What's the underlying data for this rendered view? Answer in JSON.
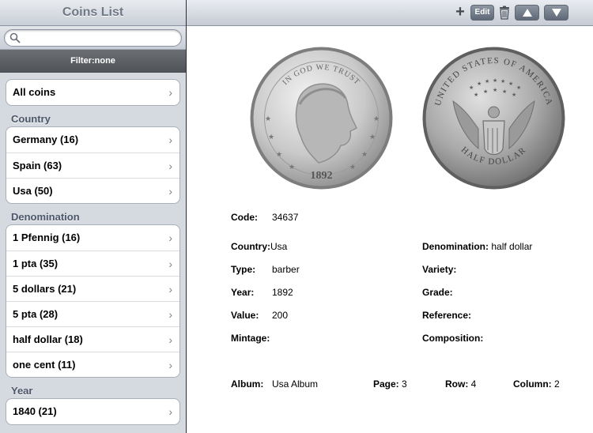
{
  "sidebar": {
    "title": "Coins List",
    "search_placeholder": "",
    "filter": "Filter:none",
    "all_coins": "All coins",
    "sections": [
      {
        "header": "Country",
        "items": [
          "Germany (16)",
          "Spain (63)",
          "Usa (50)"
        ]
      },
      {
        "header": "Denomination",
        "items": [
          "1 Pfennig (16)",
          "1 pta (35)",
          "5 dollars (21)",
          "5 pta (28)",
          "half dollar (18)",
          "one cent (11)"
        ]
      },
      {
        "header": "Year",
        "items": [
          "1840 (21)"
        ]
      }
    ]
  },
  "toolbar": {
    "edit_label": "Edit"
  },
  "coin": {
    "obverse_motto": "IN GOD WE TRUST",
    "obverse_year": "1892",
    "reverse_top": "UNITED STATES OF AMERICA",
    "reverse_bottom": "HALF DOLLAR"
  },
  "details": {
    "code_label": "Code:",
    "code_value": "34637",
    "country_label": "Country:",
    "country_value": "Usa",
    "denomination_label": "Denomination:",
    "denomination_value": "half dollar",
    "type_label": "Type:",
    "type_value": "barber",
    "variety_label": "Variety:",
    "variety_value": "",
    "year_label": "Year:",
    "year_value": "1892",
    "grade_label": "Grade:",
    "grade_value": "",
    "value_label": "Value:",
    "value_value": "200",
    "reference_label": "Reference:",
    "reference_value": "",
    "mintage_label": "Mintage:",
    "mintage_value": "",
    "composition_label": "Composition:",
    "composition_value": "",
    "album_label": "Album:",
    "album_value": "Usa Album",
    "page_label": "Page:",
    "page_value": "3",
    "row_label": "Row:",
    "row_value": "4",
    "column_label": "Column:",
    "column_value": "2"
  }
}
